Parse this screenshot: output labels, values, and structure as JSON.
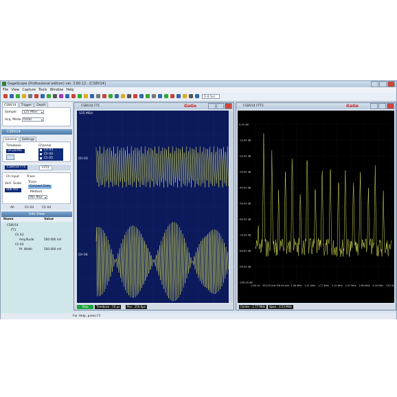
{
  "window": {
    "title": "GageScope (Professional edition) ver. 3.80.12 - [CS8V14]"
  },
  "menu": [
    "File",
    "View",
    "Capture",
    "Tools",
    "Window",
    "Help"
  ],
  "toolbar": {
    "zoom": "1:4 1cc"
  },
  "left_panel": {
    "tabs": [
      "CS8V14",
      "Trigger",
      "Depth"
    ],
    "sample_label": "Sample",
    "sample_value": "125 MS/s",
    "acq_label": "Acq. Mode",
    "acq_value": "Octal",
    "device_bar": "CS8V14",
    "sub_tabs": [
      "General",
      "Settings"
    ],
    "timebase_label": "Timebase",
    "timebase_value": "50 µs/div",
    "channel_label": "Channel",
    "channels": [
      "Ch 03",
      "Ch 04",
      "Ch 05"
    ],
    "fft_tabs": [
      "CS8V14 FT1",
      "FFT2"
    ],
    "ch_input_label": "Ch Input",
    "trace_label": "Trace",
    "vert_scale_label": "Vert. Scale",
    "vert_scale_value": "500 mV",
    "trace_options": [
      "Connect Dots",
      "Method",
      "Min-Max"
    ],
    "bottom_tabs": [
      "All",
      "Ch 03",
      "Ch 04"
    ],
    "info_view_title": "Info View",
    "info_cols": [
      "Name",
      "Value"
    ],
    "tree": [
      {
        "name": "CS8V14",
        "value": ""
      },
      {
        "name": "FT1",
        "value": ""
      },
      {
        "name": "Ch 03",
        "value": ""
      },
      {
        "name": "Amplitude",
        "value": "500.000 mV"
      },
      {
        "name": "Ch 04",
        "value": ""
      },
      {
        "name": "Pt. Width",
        "value": "500.000 mV"
      }
    ]
  },
  "scope_left": {
    "title": "CS8V14 FT1",
    "brand": "GaGe",
    "rate": "125 MS/s",
    "ch_top": "CH 03",
    "ch_bottom": "CH 04",
    "status": [
      "Stop",
      "Timebase : 50 µs",
      "Pos : 250.0µs"
    ]
  },
  "scope_right": {
    "title": "CS8V14 FFT2",
    "brand": "GaGe",
    "y_ticks": [
      "0.00 dB",
      "-10.00 dB",
      "-20.00 dB",
      "-30.00 dB",
      "-40.00 dB",
      "-50.00 dB",
      "-60.00 dB",
      "-70.00 dB",
      "-80.00 dB",
      "-90.00 dB",
      "-100.00 dB"
    ],
    "x_ticks": [
      "0.00 Hz",
      "353.25 kHz",
      "706.50 kHz",
      "1.06 MHz",
      "1.41 MHz",
      "1.77 MHz",
      "2.12 MHz",
      "2.47 MHz",
      "2.83 MHz",
      "3.18 MHz",
      "3.53 MHz"
    ],
    "status": [
      "Center : 1.77 MHz",
      "Span : 3.53 MHz"
    ]
  },
  "statusbar": "For Help, press F1",
  "colors": {
    "trace": "#e3e85a",
    "grid_left": "#0c1a5c",
    "grid_right": "#000000",
    "accent": "#0f2a78"
  }
}
